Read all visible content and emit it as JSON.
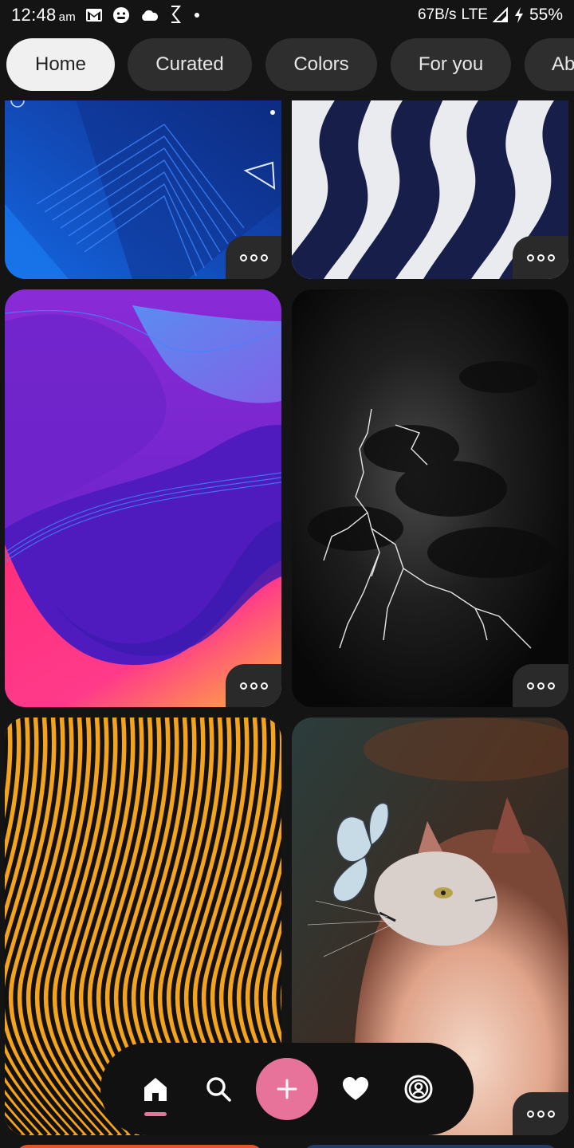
{
  "status_bar": {
    "time": "12:48",
    "ampm": "am",
    "net_speed": "67B/s",
    "network": "LTE",
    "battery": "55%",
    "icons": [
      "gmail-icon",
      "face-icon",
      "cloud-icon",
      "app-icon",
      "dot-icon",
      "signal-icon",
      "charging-icon"
    ]
  },
  "tabs": [
    {
      "label": "Home",
      "active": true
    },
    {
      "label": "Curated",
      "active": false
    },
    {
      "label": "Colors",
      "active": false
    },
    {
      "label": "For you",
      "active": false
    },
    {
      "label": "Ab",
      "active": false
    }
  ],
  "cards": [
    {
      "name": "blue-geometric-wallpaper"
    },
    {
      "name": "navy-white-wave-wallpaper"
    },
    {
      "name": "purple-pink-fluid-wallpaper"
    },
    {
      "name": "dark-lightning-clouds-wallpaper"
    },
    {
      "name": "orange-black-stripes-wallpaper"
    },
    {
      "name": "cat-butterfly-wallpaper"
    }
  ],
  "bottom_nav": {
    "items": [
      "home-icon",
      "search-icon",
      "add-icon",
      "heart-icon",
      "profile-icon"
    ]
  }
}
